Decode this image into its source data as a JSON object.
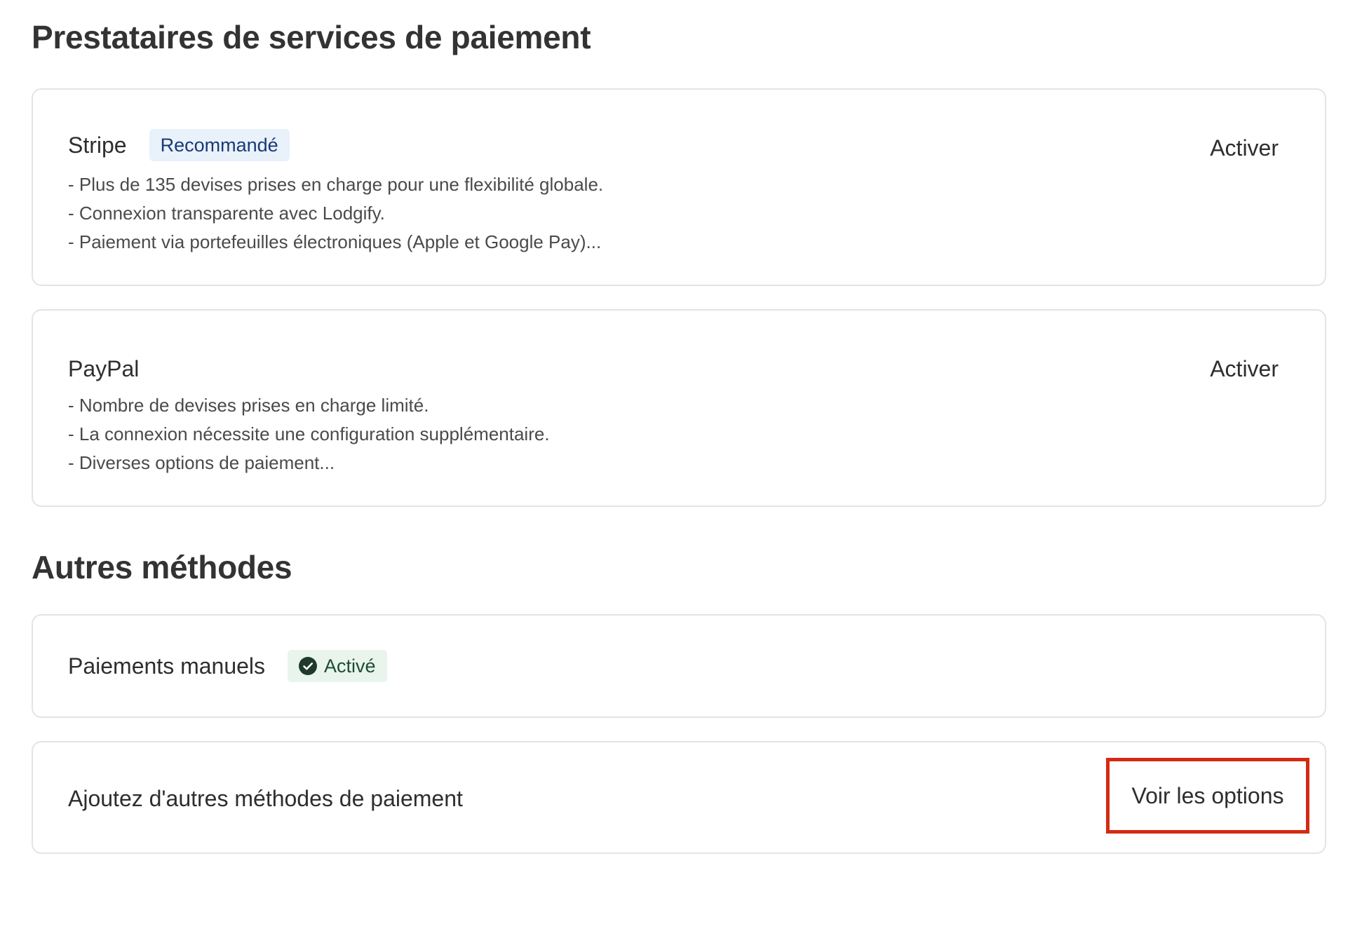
{
  "providers_section": {
    "title": "Prestataires de services de paiement",
    "stripe": {
      "name": "Stripe",
      "badge": "Recommandé",
      "action": "Activer",
      "features": [
        "- Plus de 135 devises prises en charge pour une flexibilité globale.",
        "- Connexion transparente avec Lodgify.",
        "- Paiement via portefeuilles électroniques (Apple et Google Pay)..."
      ]
    },
    "paypal": {
      "name": "PayPal",
      "action": "Activer",
      "features": [
        "- Nombre de devises prises en charge limité.",
        "- La connexion nécessite une configuration supplémentaire.",
        "- Diverses options de paiement..."
      ]
    }
  },
  "other_section": {
    "title": "Autres méthodes",
    "manual": {
      "name": "Paiements manuels",
      "status_badge": "Activé",
      "status_icon": "check-circle-icon"
    },
    "more": {
      "label": "Ajoutez d'autres méthodes de paiement",
      "action": "Voir les options"
    }
  },
  "colors": {
    "recommended_badge_bg": "#e9f1fb",
    "active_badge_bg": "#e8f4ec",
    "highlight_border": "#d42a14"
  }
}
